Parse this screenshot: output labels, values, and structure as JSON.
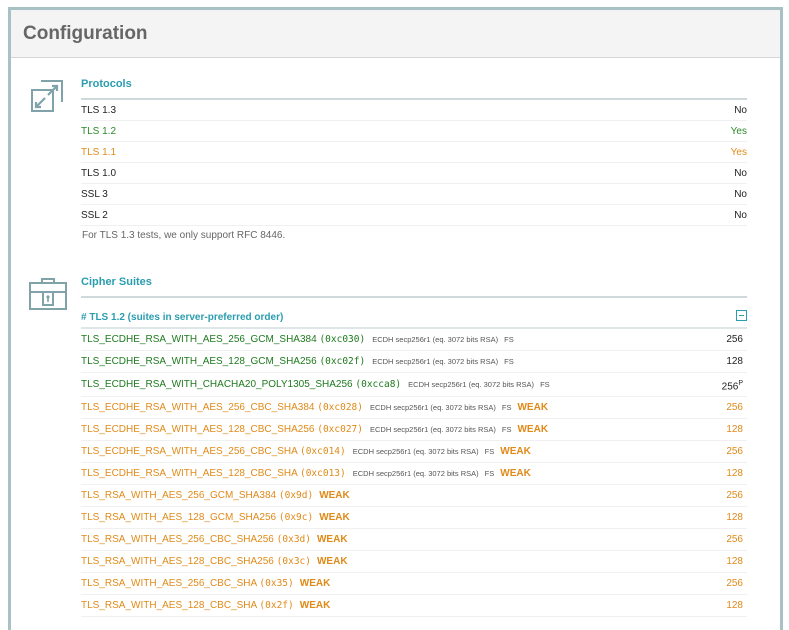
{
  "page": {
    "title": "Configuration"
  },
  "protocols": {
    "title": "Protocols",
    "rows": [
      {
        "name": "TLS 1.3",
        "value": "No",
        "status": "black"
      },
      {
        "name": "TLS 1.2",
        "value": "Yes",
        "status": "green"
      },
      {
        "name": "TLS 1.1",
        "value": "Yes",
        "status": "orange"
      },
      {
        "name": "TLS 1.0",
        "value": "No",
        "status": "black"
      },
      {
        "name": "SSL 3",
        "value": "No",
        "status": "black"
      },
      {
        "name": "SSL 2",
        "value": "No",
        "status": "black"
      }
    ],
    "note": "For TLS 1.3 tests, we only support RFC 8446."
  },
  "cipher_suites": {
    "title": "Cipher Suites",
    "group_title": "# TLS 1.2 (suites in server-preferred order)",
    "rows": [
      {
        "name": "TLS_ECDHE_RSA_WITH_AES_256_GCM_SHA384",
        "code": "(0xc030)",
        "kex": "ECDH secp256r1 (eq. 3072 bits RSA)",
        "fs": "FS",
        "weak": "",
        "bits": "256",
        "sup": "",
        "color": "green",
        "bits_color": "black"
      },
      {
        "name": "TLS_ECDHE_RSA_WITH_AES_128_GCM_SHA256",
        "code": "(0xc02f)",
        "kex": "ECDH secp256r1 (eq. 3072 bits RSA)",
        "fs": "FS",
        "weak": "",
        "bits": "128",
        "sup": "",
        "color": "green",
        "bits_color": "black"
      },
      {
        "name": "TLS_ECDHE_RSA_WITH_CHACHA20_POLY1305_SHA256",
        "code": "(0xcca8)",
        "kex": "ECDH secp256r1 (eq. 3072 bits RSA)",
        "fs": "FS",
        "weak": "",
        "bits": "256",
        "sup": "P",
        "color": "green",
        "bits_color": "black"
      },
      {
        "name": "TLS_ECDHE_RSA_WITH_AES_256_CBC_SHA384",
        "code": "(0xc028)",
        "kex": "ECDH secp256r1 (eq. 3072 bits RSA)",
        "fs": "FS",
        "weak": "WEAK",
        "bits": "256",
        "sup": "",
        "color": "orange",
        "bits_color": "orange"
      },
      {
        "name": "TLS_ECDHE_RSA_WITH_AES_128_CBC_SHA256",
        "code": "(0xc027)",
        "kex": "ECDH secp256r1 (eq. 3072 bits RSA)",
        "fs": "FS",
        "weak": "WEAK",
        "bits": "128",
        "sup": "",
        "color": "orange",
        "bits_color": "orange"
      },
      {
        "name": "TLS_ECDHE_RSA_WITH_AES_256_CBC_SHA",
        "code": "(0xc014)",
        "kex": "ECDH secp256r1 (eq. 3072 bits RSA)",
        "fs": "FS",
        "weak": "WEAK",
        "bits": "256",
        "sup": "",
        "color": "orange",
        "bits_color": "orange"
      },
      {
        "name": "TLS_ECDHE_RSA_WITH_AES_128_CBC_SHA",
        "code": "(0xc013)",
        "kex": "ECDH secp256r1 (eq. 3072 bits RSA)",
        "fs": "FS",
        "weak": "WEAK",
        "bits": "128",
        "sup": "",
        "color": "orange",
        "bits_color": "orange"
      },
      {
        "name": "TLS_RSA_WITH_AES_256_GCM_SHA384",
        "code": "(0x9d)",
        "kex": "",
        "fs": "",
        "weak": "WEAK",
        "bits": "256",
        "sup": "",
        "color": "orange",
        "bits_color": "orange"
      },
      {
        "name": "TLS_RSA_WITH_AES_128_GCM_SHA256",
        "code": "(0x9c)",
        "kex": "",
        "fs": "",
        "weak": "WEAK",
        "bits": "128",
        "sup": "",
        "color": "orange",
        "bits_color": "orange"
      },
      {
        "name": "TLS_RSA_WITH_AES_256_CBC_SHA256",
        "code": "(0x3d)",
        "kex": "",
        "fs": "",
        "weak": "WEAK",
        "bits": "256",
        "sup": "",
        "color": "orange",
        "bits_color": "orange"
      },
      {
        "name": "TLS_RSA_WITH_AES_128_CBC_SHA256",
        "code": "(0x3c)",
        "kex": "",
        "fs": "",
        "weak": "WEAK",
        "bits": "128",
        "sup": "",
        "color": "orange",
        "bits_color": "orange"
      },
      {
        "name": "TLS_RSA_WITH_AES_256_CBC_SHA",
        "code": "(0x35)",
        "kex": "",
        "fs": "",
        "weak": "WEAK",
        "bits": "256",
        "sup": "",
        "color": "orange",
        "bits_color": "orange"
      },
      {
        "name": "TLS_RSA_WITH_AES_128_CBC_SHA",
        "code": "(0x2f)",
        "kex": "",
        "fs": "",
        "weak": "WEAK",
        "bits": "128",
        "sup": "",
        "color": "orange",
        "bits_color": "orange"
      }
    ]
  },
  "icons": {
    "protocols": "expand-arrows-icon",
    "cipher_suites": "toolbox-lock-icon"
  },
  "colors": {
    "accent": "#2a9db0",
    "good": "#2a8a2a",
    "warn": "#e08a18",
    "border": "#a8c1c4"
  }
}
